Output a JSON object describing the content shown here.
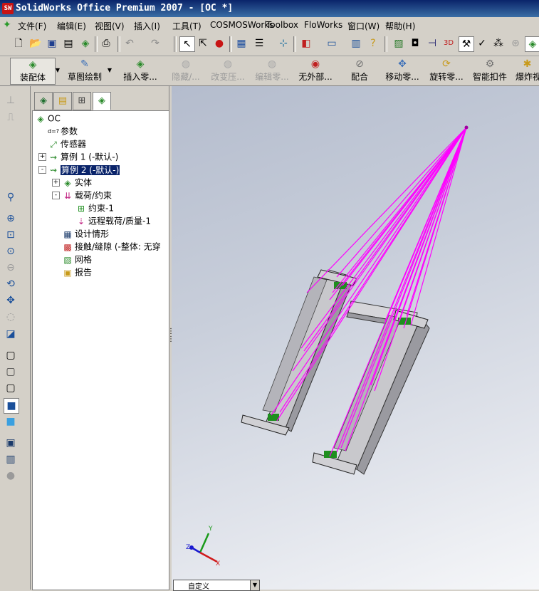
{
  "window": {
    "title": "SolidWorks Office Premium 2007 - [OC *]",
    "app_icon": "SW"
  },
  "menu": [
    {
      "label": "文件(F)"
    },
    {
      "label": "编辑(E)"
    },
    {
      "label": "视图(V)"
    },
    {
      "label": "插入(I)"
    },
    {
      "label": "工具(T)"
    },
    {
      "label": "COSMOSWorks"
    },
    {
      "label": "Toolbox"
    },
    {
      "label": "FloWorks"
    },
    {
      "label": "窗口(W)"
    },
    {
      "label": "帮助(H)"
    }
  ],
  "command_bar": {
    "items": [
      {
        "label": "装配体",
        "icon": "assembly-icon",
        "state": "pressed"
      },
      {
        "label": "草图绘制",
        "icon": "sketch-icon",
        "state": "normal"
      },
      {
        "label": "插入零...",
        "icon": "insert-component-icon",
        "state": "normal"
      },
      {
        "label": "隐藏/...",
        "icon": "hide-show-icon",
        "state": "disabled"
      },
      {
        "label": "改变压...",
        "icon": "change-suppression-icon",
        "state": "disabled"
      },
      {
        "label": "编辑零...",
        "icon": "edit-component-icon",
        "state": "disabled"
      },
      {
        "label": "无外部...",
        "icon": "no-external-refs-icon",
        "state": "normal"
      },
      {
        "label": "配合",
        "icon": "mate-icon",
        "state": "normal"
      },
      {
        "label": "移动零...",
        "icon": "move-component-icon",
        "state": "normal"
      },
      {
        "label": "旋转零...",
        "icon": "rotate-component-icon",
        "state": "normal"
      },
      {
        "label": "智能扣件",
        "icon": "smart-fasteners-icon",
        "state": "normal"
      },
      {
        "label": "爆炸视",
        "icon": "exploded-view-icon",
        "state": "normal"
      }
    ]
  },
  "tree": {
    "nodes": [
      {
        "label": "OC",
        "icon": "cosmos-root-icon",
        "depth": 0,
        "expander": "",
        "selected": false
      },
      {
        "label": "参数",
        "icon": "parameters-icon",
        "depth": 1,
        "expander": "",
        "selected": false
      },
      {
        "label": "传感器",
        "icon": "sensors-icon",
        "depth": 1,
        "expander": "",
        "selected": false
      },
      {
        "label": "算例 1 (-默认-)",
        "icon": "study-icon",
        "depth": 1,
        "expander": "+",
        "selected": false
      },
      {
        "label": "算例 2 (-默认-)",
        "icon": "study-icon",
        "depth": 1,
        "expander": "-",
        "selected": true
      },
      {
        "label": "实体",
        "icon": "solids-icon",
        "depth": 2,
        "expander": "+",
        "selected": false
      },
      {
        "label": "载荷/约束",
        "icon": "loads-restraints-icon",
        "depth": 2,
        "expander": "-",
        "selected": false
      },
      {
        "label": "约束-1",
        "icon": "restraint-icon",
        "depth": 3,
        "expander": "",
        "selected": false
      },
      {
        "label": "远程载荷/质量-1",
        "icon": "remote-load-icon",
        "depth": 3,
        "expander": "",
        "selected": false
      },
      {
        "label": "设计情形",
        "icon": "design-scenario-icon",
        "depth": 2,
        "expander": "",
        "selected": false
      },
      {
        "label": "接触/缝隙 (-整体: 无穿",
        "icon": "contact-icon",
        "depth": 2,
        "expander": "",
        "selected": false
      },
      {
        "label": "网格",
        "icon": "mesh-icon",
        "depth": 2,
        "expander": "",
        "selected": false
      },
      {
        "label": "报告",
        "icon": "report-icon",
        "depth": 2,
        "expander": "",
        "selected": false
      }
    ]
  },
  "triad": {
    "x": "X",
    "y": "Y",
    "z": "Z"
  },
  "view_orientation": {
    "value": "自定义"
  },
  "colors": {
    "load_lines": "#ff00ff",
    "title_bar": "#0a246a",
    "selection": "#0a246a",
    "restraint": "#1f8f1f"
  }
}
